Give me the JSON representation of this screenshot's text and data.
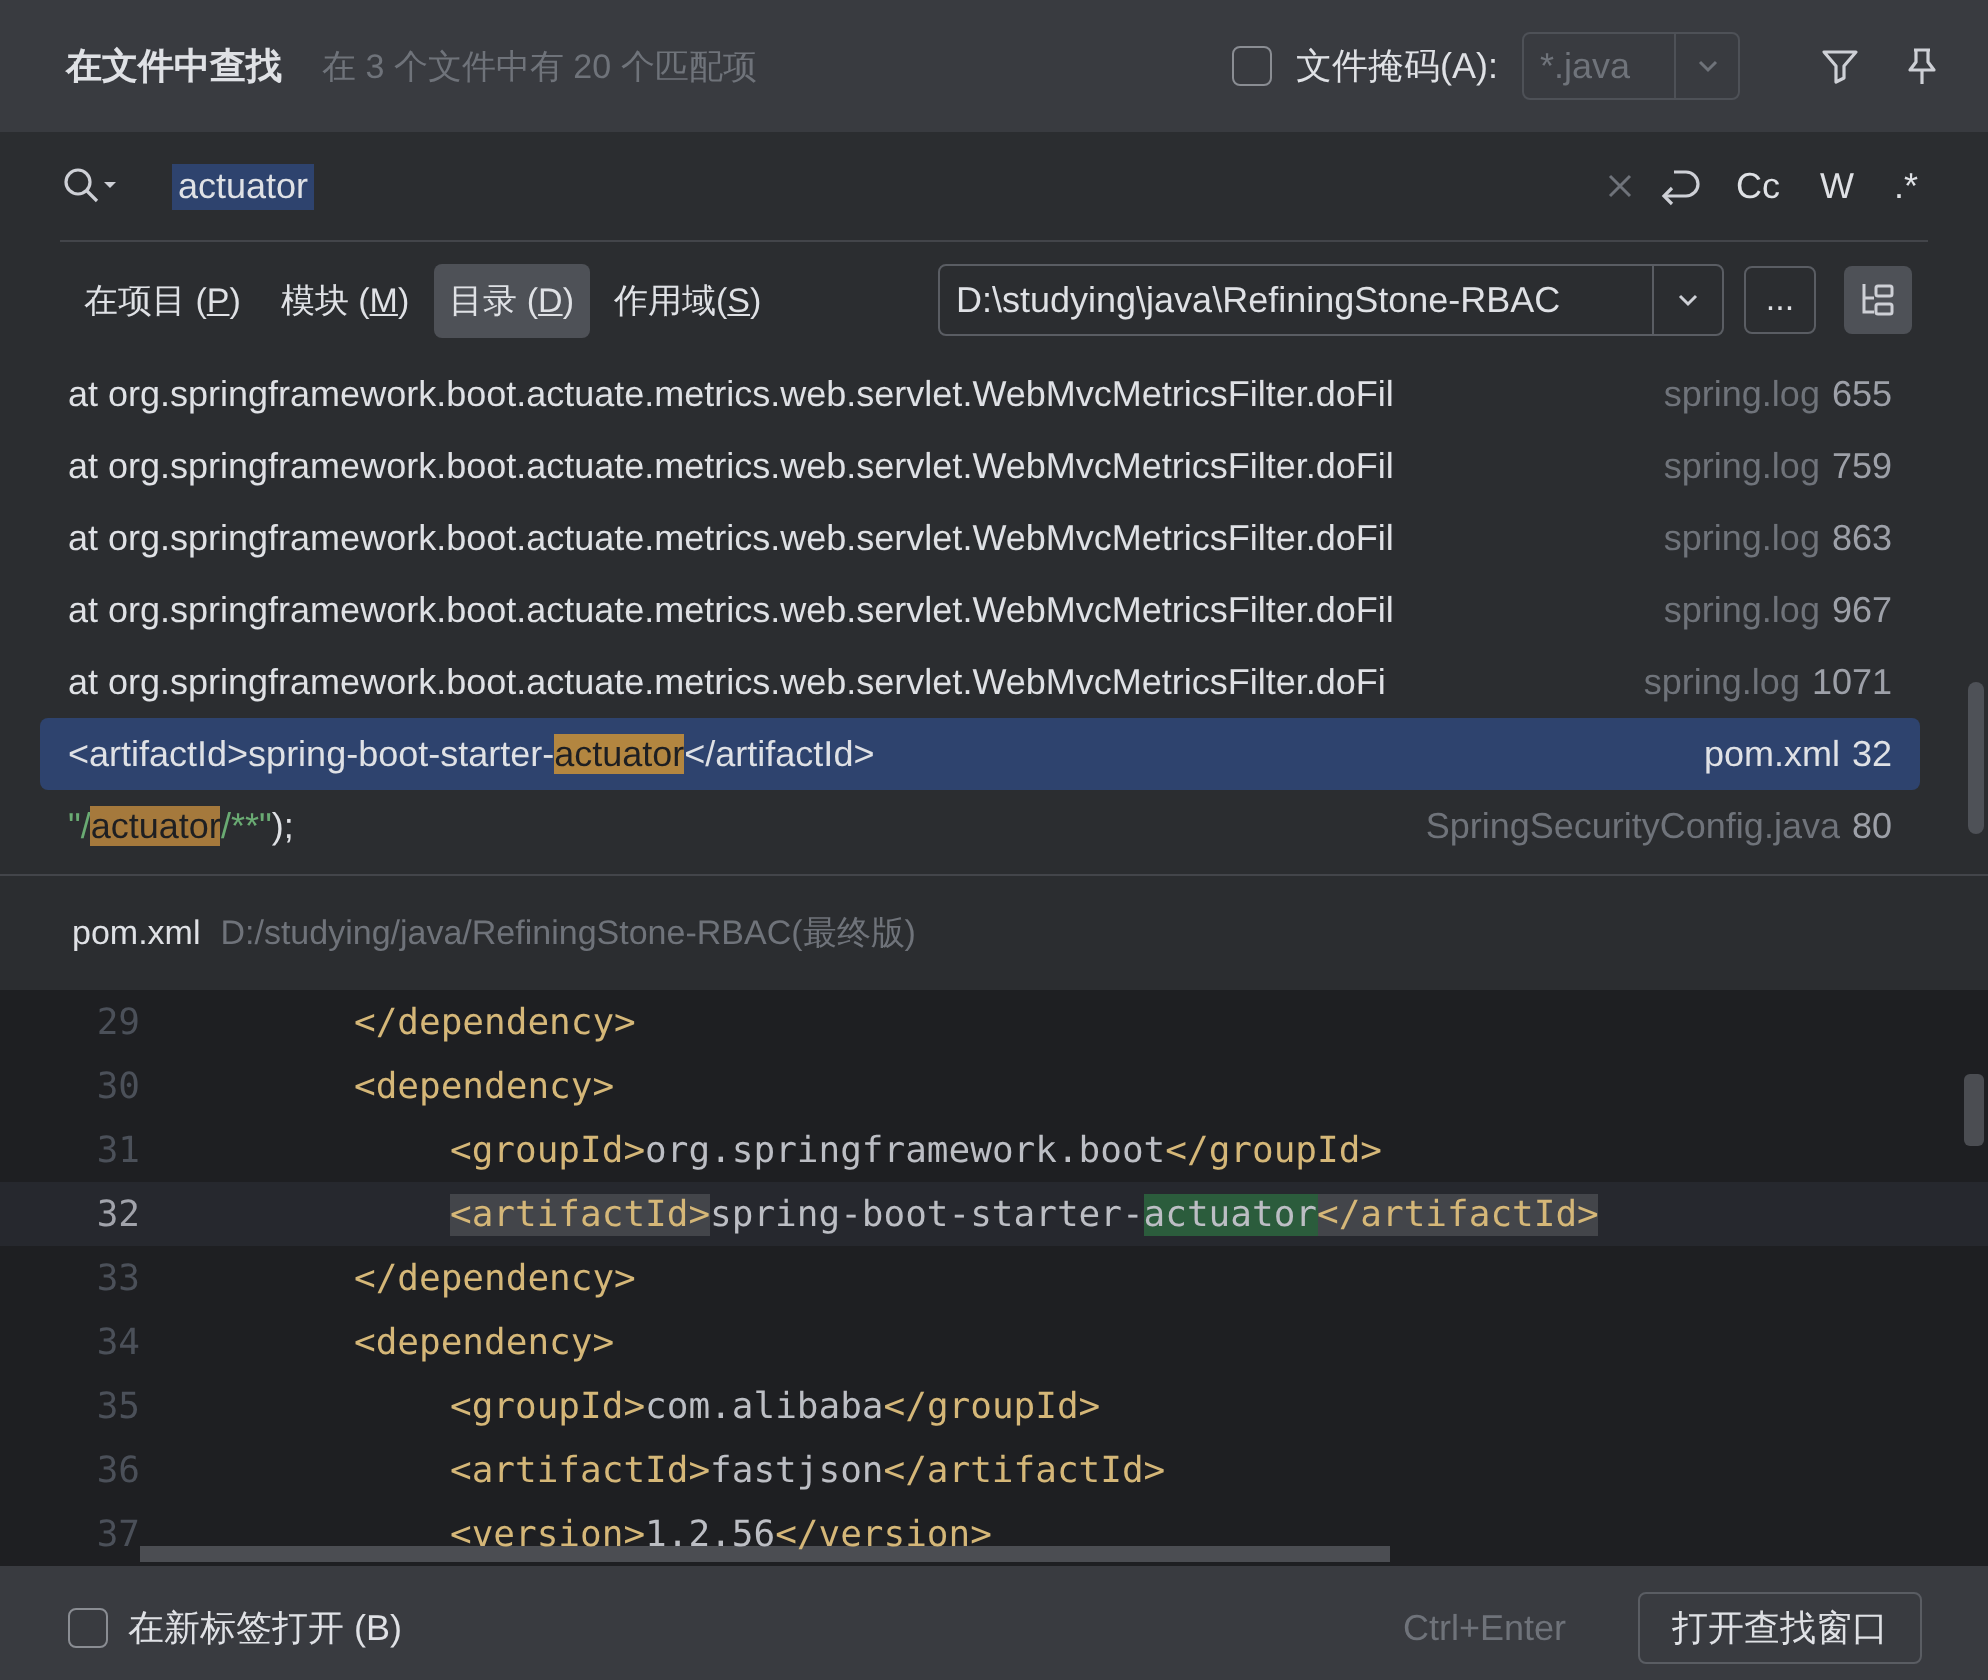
{
  "header": {
    "title": "在文件中查找",
    "summary": "在 3 个文件中有 20 个匹配项",
    "file_mask": {
      "label": "文件掩码(A):",
      "checked": false,
      "value": "*.java",
      "disabled": true
    }
  },
  "search": {
    "query": "actuator",
    "toggles": [
      {
        "label": "Cc",
        "selected": false
      },
      {
        "label": "W",
        "selected": false
      },
      {
        "label": ".*",
        "selected": false
      }
    ]
  },
  "scopes": [
    {
      "label": "在项目 (",
      "mnemonic": "P",
      "label_end": ")",
      "selected": false
    },
    {
      "label": "模块 (",
      "mnemonic": "M",
      "label_end": ")",
      "selected": false
    },
    {
      "label": "目录 (",
      "mnemonic": "D",
      "label_end": ")",
      "selected": true
    },
    {
      "label": "作用域(",
      "mnemonic": "S",
      "label_end": ")",
      "selected": false
    }
  ],
  "directory": {
    "value": "D:\\studying\\java\\RefiningStone-RBAC",
    "more": "...",
    "tree_view": true
  },
  "results": [
    {
      "selected": false,
      "segments": [
        {
          "kind": "plain",
          "text": "at org.springframework.boot.actuate.metrics.web.servlet.WebMvcMetricsFilter.doFil"
        }
      ],
      "file": "spring.log",
      "line": "655"
    },
    {
      "selected": false,
      "segments": [
        {
          "kind": "plain",
          "text": "at org.springframework.boot.actuate.metrics.web.servlet.WebMvcMetricsFilter.doFil"
        }
      ],
      "file": "spring.log",
      "line": "759"
    },
    {
      "selected": false,
      "segments": [
        {
          "kind": "plain",
          "text": "at org.springframework.boot.actuate.metrics.web.servlet.WebMvcMetricsFilter.doFil"
        }
      ],
      "file": "spring.log",
      "line": "863"
    },
    {
      "selected": false,
      "segments": [
        {
          "kind": "plain",
          "text": "at org.springframework.boot.actuate.metrics.web.servlet.WebMvcMetricsFilter.doFil"
        }
      ],
      "file": "spring.log",
      "line": "967"
    },
    {
      "selected": false,
      "segments": [
        {
          "kind": "plain",
          "text": "at org.springframework.boot.actuate.metrics.web.servlet.WebMvcMetricsFilter.doFi"
        }
      ],
      "file": "spring.log",
      "line": "1071"
    },
    {
      "selected": true,
      "segments": [
        {
          "kind": "plain",
          "text": "<artifactId>spring-boot-starter-"
        },
        {
          "kind": "match",
          "text": "actuator"
        },
        {
          "kind": "plain",
          "text": "</artifactId>"
        }
      ],
      "file": "pom.xml",
      "line": "32"
    },
    {
      "selected": false,
      "segments": [
        {
          "kind": "string",
          "text": "\"/"
        },
        {
          "kind": "match",
          "text": "actuator"
        },
        {
          "kind": "string",
          "text": "/**\""
        },
        {
          "kind": "plain",
          "text": ");"
        }
      ],
      "file": "SpringSecurityConfig.java",
      "line": "80"
    }
  ],
  "preview": {
    "file": "pom.xml",
    "path": "D:/studying/java/RefiningStone-RBAC(最终版)",
    "lines": [
      {
        "number": "29",
        "current": false,
        "nested": false,
        "segments": [
          {
            "kind": "tag",
            "text": "</dependency>"
          }
        ]
      },
      {
        "number": "30",
        "current": false,
        "nested": false,
        "segments": [
          {
            "kind": "tag",
            "text": "<dependency>"
          }
        ]
      },
      {
        "number": "31",
        "current": false,
        "nested": true,
        "segments": [
          {
            "kind": "tag",
            "text": "<groupId>"
          },
          {
            "kind": "text",
            "text": "org.springframework.boot"
          },
          {
            "kind": "tag",
            "text": "</groupId>"
          }
        ]
      },
      {
        "number": "32",
        "current": true,
        "nested": true,
        "segments": [
          {
            "kind": "tag-paired",
            "text": "<artifactId>"
          },
          {
            "kind": "text",
            "text": "spring-boot-starter-"
          },
          {
            "kind": "match",
            "text": "actuator"
          },
          {
            "kind": "tag-paired",
            "text": "</artifactId>"
          }
        ]
      },
      {
        "number": "33",
        "current": false,
        "nested": false,
        "segments": [
          {
            "kind": "tag",
            "text": "</dependency>"
          }
        ]
      },
      {
        "number": "34",
        "current": false,
        "nested": false,
        "segments": [
          {
            "kind": "tag",
            "text": "<dependency>"
          }
        ]
      },
      {
        "number": "35",
        "current": false,
        "nested": true,
        "segments": [
          {
            "kind": "tag",
            "text": "<groupId>"
          },
          {
            "kind": "text",
            "text": "com.alibaba"
          },
          {
            "kind": "tag",
            "text": "</groupId>"
          }
        ]
      },
      {
        "number": "36",
        "current": false,
        "nested": true,
        "segments": [
          {
            "kind": "tag",
            "text": "<artifactId>"
          },
          {
            "kind": "text",
            "text": "fastjson"
          },
          {
            "kind": "tag",
            "text": "</artifactId>"
          }
        ]
      },
      {
        "number": "37",
        "current": false,
        "nested": true,
        "segments": [
          {
            "kind": "tag",
            "text": "<version>"
          },
          {
            "kind": "text",
            "text": "1.2.56"
          },
          {
            "kind": "tag",
            "text": "</version>"
          }
        ]
      }
    ]
  },
  "footer": {
    "new_tab": {
      "label": "在新标签打开 (B)",
      "checked": false
    },
    "shortcut": "Ctrl+Enter",
    "open_button": "打开查找窗口"
  }
}
